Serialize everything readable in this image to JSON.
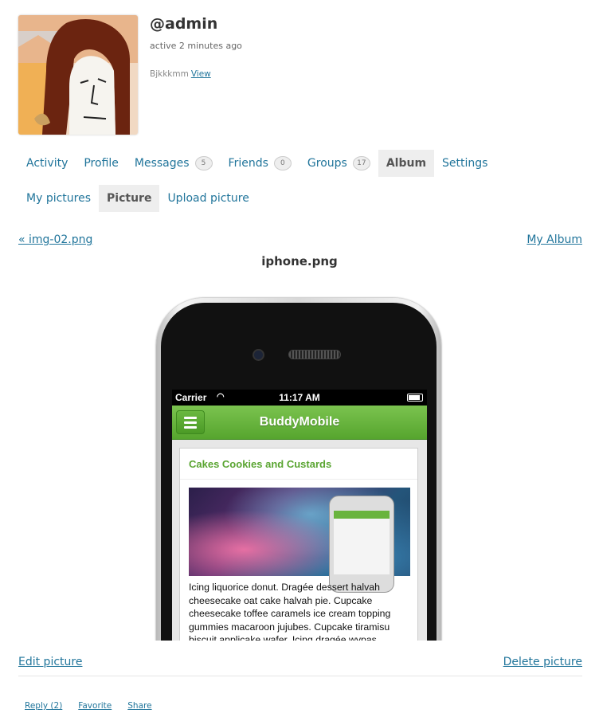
{
  "profile": {
    "username": "@admin",
    "active_time": "active 2 minutes ago",
    "latest_update": "Bjkkkmm",
    "view_link": "View"
  },
  "nav": {
    "main": [
      {
        "label": "Activity"
      },
      {
        "label": "Profile"
      },
      {
        "label": "Messages",
        "count": "5"
      },
      {
        "label": "Friends",
        "count": "0"
      },
      {
        "label": "Groups",
        "count": "17"
      },
      {
        "label": "Album",
        "current": true
      },
      {
        "label": "Settings"
      }
    ],
    "sub": [
      {
        "label": "My pictures"
      },
      {
        "label": "Picture",
        "current": true
      },
      {
        "label": "Upload picture"
      }
    ]
  },
  "picture": {
    "prev_link": "« img-02.png",
    "album_link": "My Album",
    "title": "iphone.png",
    "screenshot": {
      "carrier": "Carrier",
      "time": "11:17 AM",
      "app_title": "BuddyMobile",
      "post_title": "Cakes Cookies and Custards",
      "post_text": "Icing liquorice donut. Dragée dessert halvah cheesecake oat cake halvah pie. Cupcake cheesecake toffee caramels ice cream topping gummies macaroon jujubes. Cupcake tiramisu biscuit applicake wafer. Icing dragée wypas"
    }
  },
  "footer": {
    "edit_link": "Edit picture",
    "delete_link": "Delete picture",
    "actions": {
      "reply": "Reply (2)",
      "favorite": "Favorite",
      "share": "Share"
    }
  },
  "colors": {
    "link": "#21759b",
    "current_tab_bg": "#eeeeee",
    "app_green": "#5aa532"
  }
}
